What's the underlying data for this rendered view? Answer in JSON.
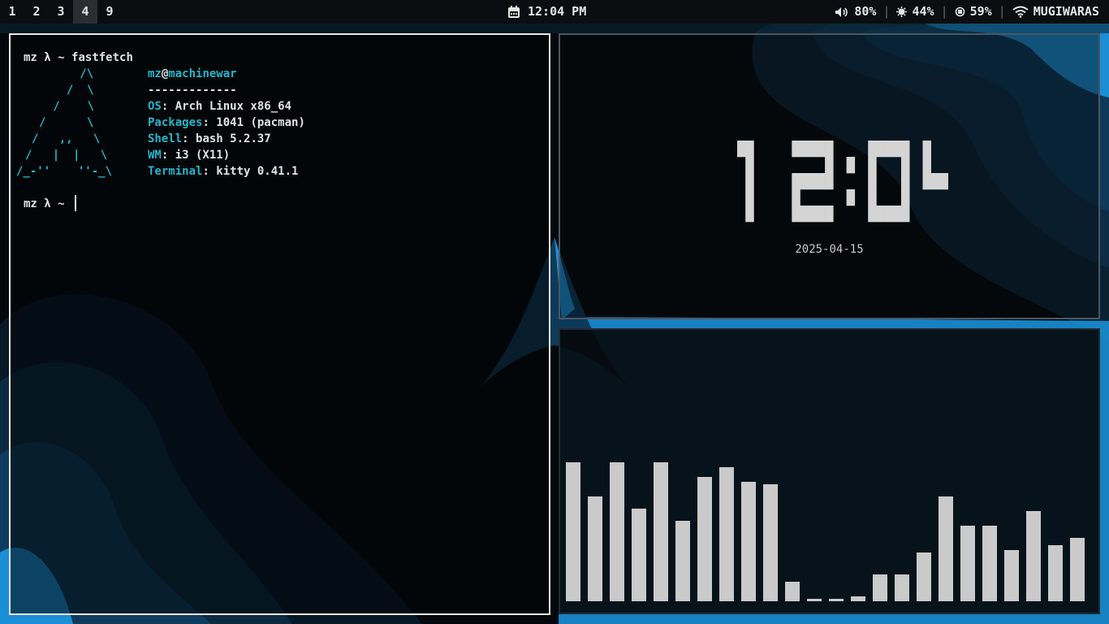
{
  "workspaces": [
    {
      "label": "1",
      "active": false
    },
    {
      "label": "2",
      "active": false
    },
    {
      "label": "3",
      "active": false
    },
    {
      "label": "4",
      "active": true
    },
    {
      "label": "9",
      "active": false
    }
  ],
  "bar": {
    "time": "12:04 PM",
    "volume": "80%",
    "cpu": "44%",
    "memory": "59%",
    "network": "MUGIWARAS"
  },
  "terminal": {
    "prompt_user": "mz",
    "prompt_symbol": "λ ~",
    "command": "fastfetch",
    "logo_lines": [
      "   /\\",
      "  /  \\",
      " /    \\",
      "/      \\",
      "/   ,,   \\",
      "/   |  |   \\",
      "/_-''    ''-_\\"
    ],
    "user": "mz",
    "at": "@",
    "host": "machinewar",
    "divider": "-------------",
    "info": [
      {
        "key": "OS",
        "value": "Arch Linux x86_64"
      },
      {
        "key": "Packages",
        "value": "1041 (pacman)"
      },
      {
        "key": "Shell",
        "value": "bash 5.2.37"
      },
      {
        "key": "WM",
        "value": "i3 (X11)"
      },
      {
        "key": "Terminal",
        "value": "kitty 0.41.1"
      }
    ]
  },
  "clock": {
    "time": "12:04",
    "date": "2025-04-15"
  },
  "visualizer": {
    "color": "#cacaca",
    "levels": [
      0.57,
      0.43,
      0.57,
      0.38,
      0.57,
      0.33,
      0.51,
      0.55,
      0.49,
      0.48,
      0.08,
      0.01,
      0.01,
      0.02,
      0.11,
      0.11,
      0.2,
      0.43,
      0.31,
      0.31,
      0.21,
      0.37,
      0.23,
      0.26
    ]
  },
  "colors": {
    "accent": "#26b6c9",
    "wallpaper_blue": "#1a8fd6"
  }
}
